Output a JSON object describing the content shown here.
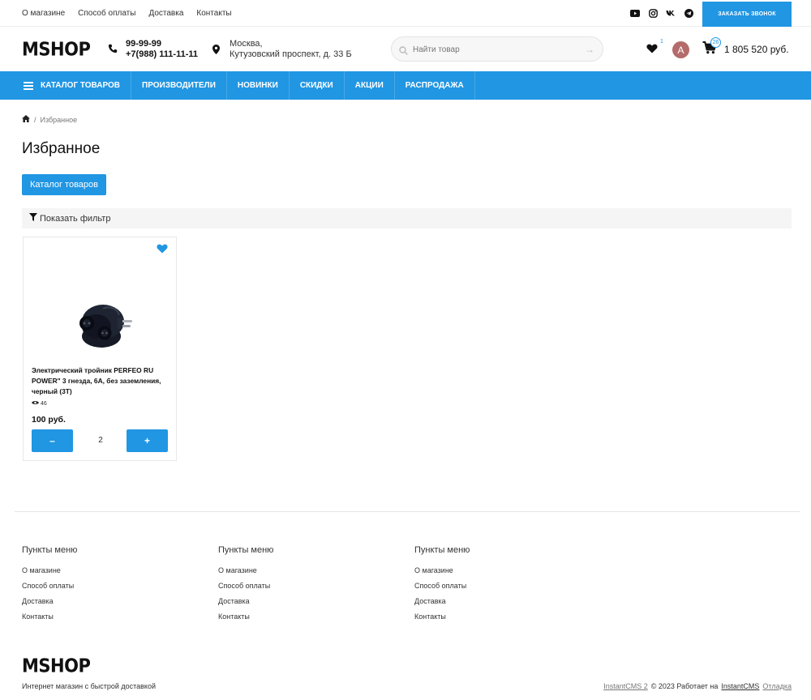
{
  "topbar": {
    "links": [
      "О магазине",
      "Способ оплаты",
      "Доставка",
      "Контакты"
    ],
    "social_icons": [
      "youtube-icon",
      "instagram-icon",
      "vk-icon",
      "telegram-icon"
    ],
    "callback_label": "ЗАКАЗАТЬ ЗВОНОК"
  },
  "header": {
    "logo": "MSHOP",
    "phone1": "99-99-99",
    "phone2": "+7(988) 111-11-11",
    "address_line1": "Москва,",
    "address_line2": "Кутузовский проспект, д. 33 Б",
    "search_placeholder": "Найти товар",
    "favorites_count": "1",
    "avatar_letter": "А",
    "cart_count": "26",
    "cart_total": "1 805 520 руб."
  },
  "nav": {
    "items": [
      "КАТАЛОГ ТОВАРОВ",
      "ПРОИЗВОДИТЕЛИ",
      "НОВИНКИ",
      "СКИДКИ",
      "АКЦИИ",
      "РАСПРОДАЖА"
    ]
  },
  "page": {
    "breadcrumb": "Избранное",
    "title": "Избранное",
    "catalog_button": "Каталог товаров",
    "filter_label": "Показать фильтр"
  },
  "product": {
    "name": "Электрический тройник PERFEO RU POWER\" 3 гнезда, 6А, без заземления, черный (3Т)",
    "views": "46",
    "price": "100 руб.",
    "quantity": "2",
    "minus_label": "–",
    "plus_label": "+"
  },
  "footer": {
    "columns": [
      {
        "title": "Пункты меню",
        "links": [
          "О магазине",
          "Способ оплаты",
          "Доставка",
          "Контакты"
        ]
      },
      {
        "title": "Пункты меню",
        "links": [
          "О магазине",
          "Способ оплаты",
          "Доставка",
          "Контакты"
        ]
      },
      {
        "title": "Пункты меню",
        "links": [
          "О магазине",
          "Способ оплаты",
          "Доставка",
          "Контакты"
        ]
      }
    ],
    "logo": "MSHOP",
    "tagline": "Интернет магазин с быстрой доставкой",
    "cms_link": "InstantCMS 2",
    "copyright": "© 2023  Работает на",
    "powered_link": "InstantCMS",
    "debug_link": "Отладка"
  },
  "colors": {
    "accent": "#2196e3",
    "avatar": "#b36b6b"
  }
}
